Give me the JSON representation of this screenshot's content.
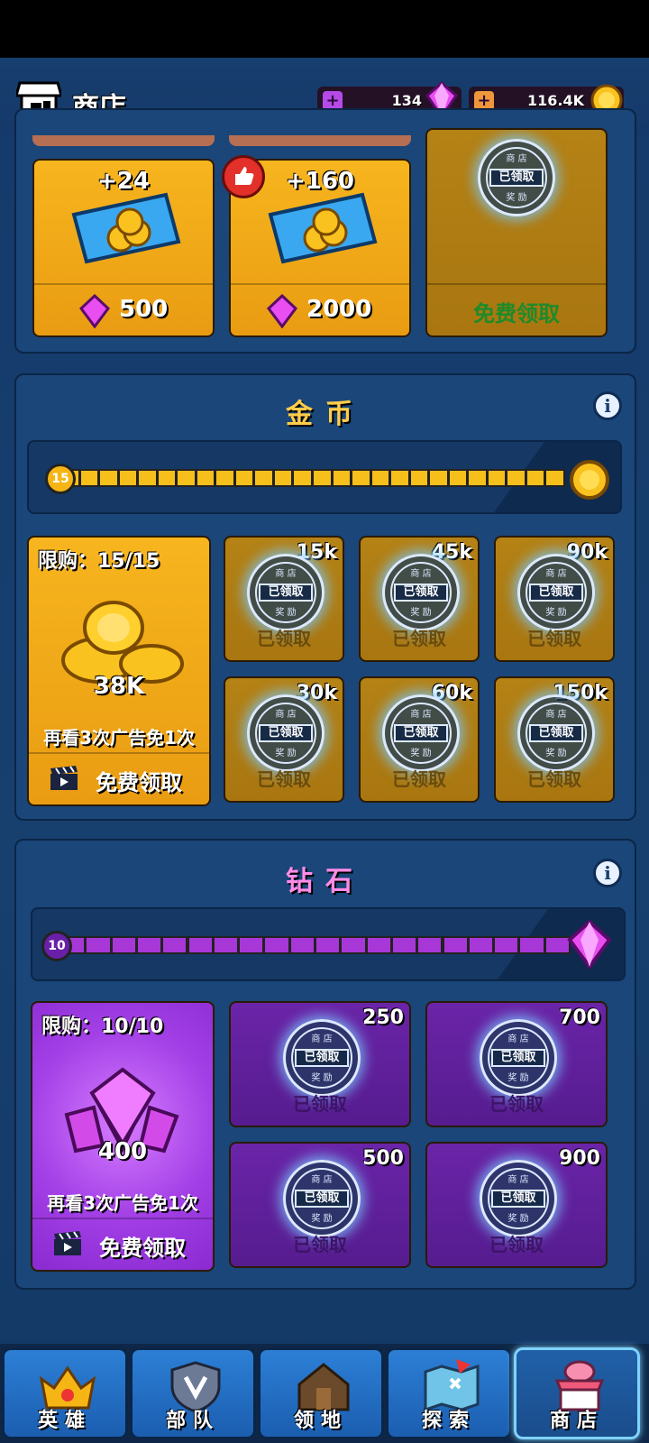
{
  "header": {
    "title": "商店",
    "gems": "134",
    "coins": "116.4K"
  },
  "top_offers": [
    {
      "amount": "+24",
      "price": "500"
    },
    {
      "amount": "+160",
      "price": "2000"
    },
    {
      "claim_text": "免费领取"
    }
  ],
  "stamp": {
    "top": "商 店",
    "main": "已领取",
    "bottom": "奖 励"
  },
  "claimed_text": "已领取",
  "gold_section": {
    "title": "金币",
    "level": "15",
    "limit": "限购：15/15",
    "featured_amount": "38K",
    "ad_text": "再看3次广告免1次",
    "free_label": "免费领取",
    "tiers": [
      "15k",
      "45k",
      "90k",
      "30k",
      "60k",
      "150k"
    ]
  },
  "gem_section": {
    "title": "钻石",
    "level": "10",
    "limit": "限购：10/10",
    "featured_amount": "400",
    "ad_text": "再看3次广告免1次",
    "free_label": "免费领取",
    "tiers": [
      "250",
      "700",
      "500",
      "900"
    ]
  },
  "nav": [
    {
      "label": "英雄",
      "icon": "crown-icon"
    },
    {
      "label": "部队",
      "icon": "troop-shield-icon"
    },
    {
      "label": "领地",
      "icon": "territory-house-icon"
    },
    {
      "label": "探索",
      "icon": "map-icon"
    },
    {
      "label": "商店",
      "icon": "shop-icon"
    }
  ],
  "colors": {
    "gold": "#f7b51e",
    "purple": "#6a24a8",
    "panel": "#1a4679",
    "active_nav": "#7fd3ff"
  }
}
